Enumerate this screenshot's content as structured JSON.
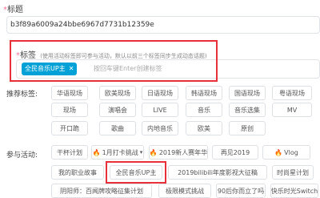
{
  "title_section": {
    "label": "标题",
    "value": "b3f89a6009a24bbe6967d7731b12359e"
  },
  "tags_section": {
    "label": "标签",
    "hint": "(使用活动标签即可参与活动，默认以前三个标签同步生成动态话题)",
    "selected_tag": "全民音乐UP主",
    "input_placeholder": "按回车键Enter创建标签"
  },
  "recommended": {
    "label": "推荐标签:",
    "rows": [
      [
        "华语现场",
        "欧美现场",
        "日语现场",
        "韩语现场",
        "国语现场",
        "粤语现场"
      ],
      [
        "现场",
        "演唱会",
        "LIVE",
        "音乐",
        "音乐选集",
        "MV"
      ],
      [
        "开口跪",
        "歌曲",
        "内地音乐",
        "欧美",
        "原创"
      ]
    ]
  },
  "activities": {
    "label": "参与活动:",
    "rows": [
      [
        {
          "text": "干杯计划",
          "hot": false
        },
        {
          "text": "1月打卡挑战",
          "hot": true,
          "dropdown": true
        },
        {
          "text": "2019新人赛年华",
          "hot": true
        },
        {
          "text": "再见2019",
          "hot": false
        },
        {
          "text": "Vlog",
          "hot": true
        }
      ],
      [
        {
          "text": "我的职业故事",
          "hot": false
        },
        {
          "text": "全民音乐UP主",
          "hot": false
        },
        {
          "text": "2019bilibili年度影视大征稿",
          "hot": false
        },
        {
          "text": "时尚星计划",
          "hot": false
        }
      ],
      [
        {
          "text": "阴阳师：百闻牌攻略征集计划",
          "hot": false
        },
        {
          "text": "极限模式挑战",
          "hot": false
        },
        {
          "text": "90后你而立了吗",
          "hot": false
        },
        {
          "text": "快乐时光Switch",
          "hot": false
        }
      ]
    ]
  },
  "colors": {
    "accent": "#00a1d6",
    "highlight_box": "#e8303b",
    "required": "#fb7299"
  }
}
